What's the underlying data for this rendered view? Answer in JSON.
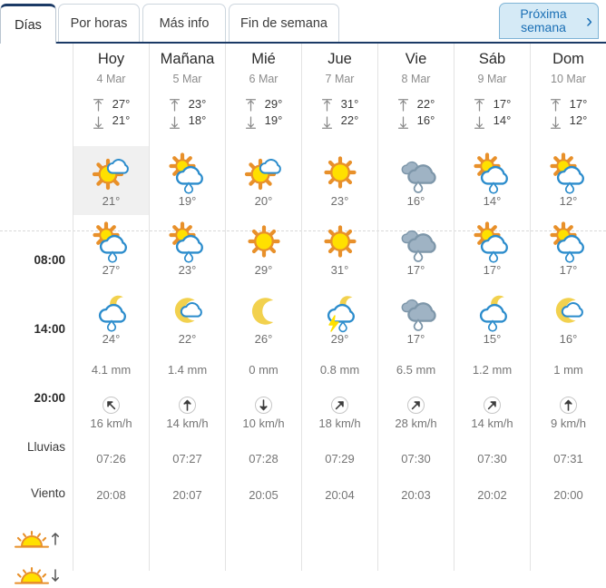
{
  "tabs": [
    {
      "id": "dias",
      "label": "Días",
      "active": true
    },
    {
      "id": "horas",
      "label": "Por horas",
      "active": false
    },
    {
      "id": "info",
      "label": "Más info",
      "active": false
    },
    {
      "id": "finde",
      "label": "Fin de semana",
      "active": false
    }
  ],
  "next_week": {
    "label": "Próxima semana",
    "icon": "chevron-right-icon"
  },
  "row_labels": {
    "h08": "08:00",
    "h14": "14:00",
    "h20": "20:00",
    "rain": "Lluvias",
    "wind": "Viento",
    "sunrise_icon": "sunrise-icon",
    "sunset_icon": "sunset-icon"
  },
  "units": {
    "temp": "°",
    "rain": "mm",
    "wind": "km/h"
  },
  "days": [
    {
      "name": "Hoy",
      "date": "4 Mar",
      "tmax": "27°",
      "tmin": "21°",
      "h08": {
        "icon": "sun-cloud-icon",
        "temp": "21°",
        "highlight": true
      },
      "h14": {
        "icon": "sun-cloud-rain-icon",
        "temp": "27°",
        "highlight": false
      },
      "h20": {
        "icon": "moon-cloud-rain-icon",
        "temp": "24°",
        "highlight": false
      },
      "rain": "4.1 mm",
      "wind": {
        "speed": "16 km/h",
        "dir_deg": 315,
        "icon": "wind-arrow-nw-icon"
      },
      "sunrise": "07:26",
      "sunset": "20:08"
    },
    {
      "name": "Mañana",
      "date": "5 Mar",
      "tmax": "23°",
      "tmin": "18°",
      "h08": {
        "icon": "sun-cloud-rain-icon",
        "temp": "19°",
        "highlight": false
      },
      "h14": {
        "icon": "sun-cloud-rain-icon",
        "temp": "23°",
        "highlight": false
      },
      "h20": {
        "icon": "moon-cloud-icon",
        "temp": "22°",
        "highlight": false
      },
      "rain": "1.4 mm",
      "wind": {
        "speed": "14 km/h",
        "dir_deg": 0,
        "icon": "wind-arrow-n-icon"
      },
      "sunrise": "07:27",
      "sunset": "20:07"
    },
    {
      "name": "Mié",
      "date": "6 Mar",
      "tmax": "29°",
      "tmin": "19°",
      "h08": {
        "icon": "sun-cloud-icon",
        "temp": "20°",
        "highlight": false
      },
      "h14": {
        "icon": "sun-icon",
        "temp": "29°",
        "highlight": false
      },
      "h20": {
        "icon": "moon-icon",
        "temp": "26°",
        "highlight": false
      },
      "rain": "0 mm",
      "wind": {
        "speed": "10 km/h",
        "dir_deg": 180,
        "icon": "wind-arrow-s-icon"
      },
      "sunrise": "07:28",
      "sunset": "20:05"
    },
    {
      "name": "Jue",
      "date": "7 Mar",
      "tmax": "31°",
      "tmin": "22°",
      "h08": {
        "icon": "sun-icon",
        "temp": "23°",
        "highlight": false
      },
      "h14": {
        "icon": "sun-icon",
        "temp": "31°",
        "highlight": false
      },
      "h20": {
        "icon": "moon-storm-icon",
        "temp": "29°",
        "highlight": false
      },
      "rain": "0.8 mm",
      "wind": {
        "speed": "18 km/h",
        "dir_deg": 45,
        "icon": "wind-arrow-ne-icon"
      },
      "sunrise": "07:29",
      "sunset": "20:04"
    },
    {
      "name": "Vie",
      "date": "8 Mar",
      "tmax": "22°",
      "tmin": "16°",
      "h08": {
        "icon": "cloud-rain-icon",
        "temp": "16°",
        "highlight": false
      },
      "h14": {
        "icon": "cloud-rain-icon",
        "temp": "17°",
        "highlight": false
      },
      "h20": {
        "icon": "cloud-rain-icon",
        "temp": "17°",
        "highlight": false
      },
      "rain": "6.5 mm",
      "wind": {
        "speed": "28 km/h",
        "dir_deg": 45,
        "icon": "wind-arrow-ne-icon"
      },
      "sunrise": "07:30",
      "sunset": "20:03"
    },
    {
      "name": "Sáb",
      "date": "9 Mar",
      "tmax": "17°",
      "tmin": "14°",
      "h08": {
        "icon": "sun-cloud-rain-icon",
        "temp": "14°",
        "highlight": false
      },
      "h14": {
        "icon": "sun-cloud-rain-icon",
        "temp": "17°",
        "highlight": false
      },
      "h20": {
        "icon": "moon-cloud-rain-icon",
        "temp": "15°",
        "highlight": false
      },
      "rain": "1.2 mm",
      "wind": {
        "speed": "14 km/h",
        "dir_deg": 45,
        "icon": "wind-arrow-ne-icon"
      },
      "sunrise": "07:30",
      "sunset": "20:02"
    },
    {
      "name": "Dom",
      "date": "10 Mar",
      "tmax": "17°",
      "tmin": "12°",
      "h08": {
        "icon": "sun-cloud-rain-icon",
        "temp": "12°",
        "highlight": false
      },
      "h14": {
        "icon": "sun-cloud-rain-icon",
        "temp": "17°",
        "highlight": false
      },
      "h20": {
        "icon": "moon-cloud-icon",
        "temp": "16°",
        "highlight": false
      },
      "rain": "1 mm",
      "wind": {
        "speed": "9 km/h",
        "dir_deg": 0,
        "icon": "wind-arrow-n-icon"
      },
      "sunrise": "07:31",
      "sunset": "20:00"
    }
  ],
  "colors": {
    "accent_blue": "#1a6fb5",
    "active_tab_border": "#1b3a66",
    "sun_yellow": "#ffe000",
    "sun_orange": "#e8902a",
    "cloud_blue": "#2b8ccc",
    "cloud_gray": "#9fb3c4",
    "moon_yellow": "#f2d14e",
    "highlight_bg": "#f0f0f0"
  }
}
